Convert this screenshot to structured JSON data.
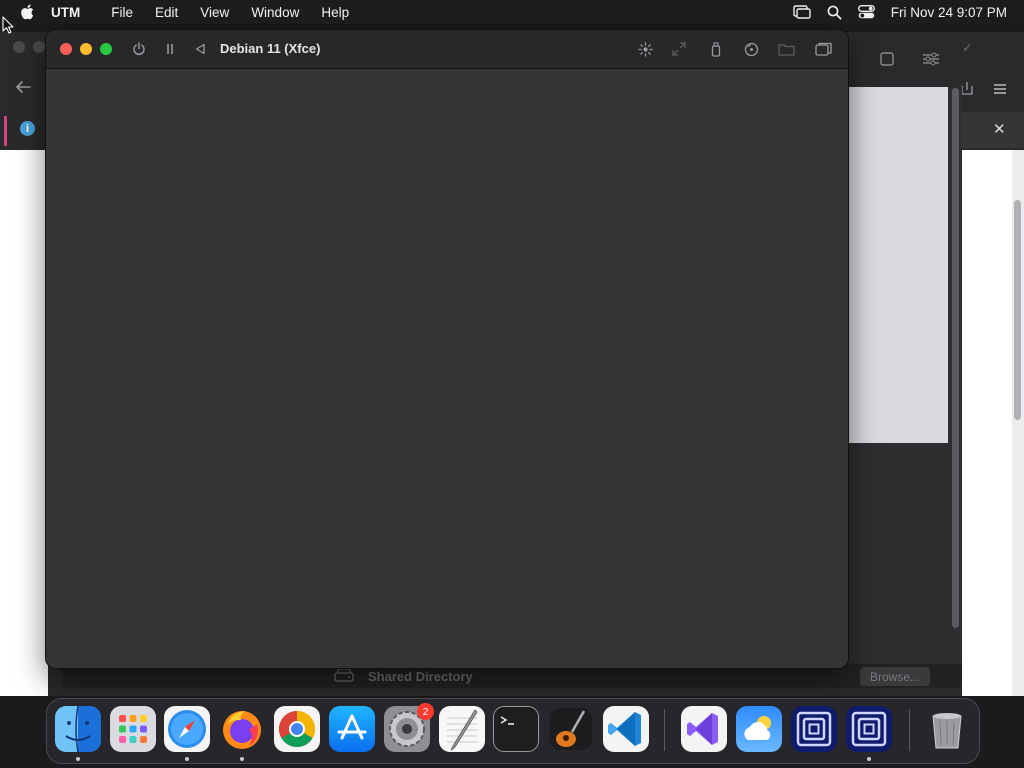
{
  "menubar": {
    "app_name": "UTM",
    "items": [
      "File",
      "Edit",
      "View",
      "Window",
      "Help"
    ],
    "clock": "Fri Nov 24  9:07 PM",
    "status_icons": [
      "screen-mirroring-icon",
      "spotlight-search-icon",
      "control-center-icon"
    ]
  },
  "vm_window": {
    "title": "Debian 11 (Xfce)",
    "controls": [
      "power-icon",
      "pause-icon",
      "restart-icon"
    ],
    "toolbar": [
      "display-brightness-icon",
      "resize-icon",
      "usb-icon",
      "drive-icon",
      "shared-folder-icon",
      "windows-icon"
    ],
    "traffic_colors": {
      "close": "#ff5f57",
      "minimize": "#febc2e",
      "maximize": "#28c840"
    }
  },
  "background_window": {
    "shared_directory_label": "Shared Directory",
    "browse_button": "Browse...",
    "info_badge": "i",
    "close_glyph": "✕"
  },
  "dock": {
    "apps": [
      {
        "name": "Finder",
        "running": true
      },
      {
        "name": "Launchpad",
        "running": false
      },
      {
        "name": "Safari",
        "running": true
      },
      {
        "name": "Firefox",
        "running": true
      },
      {
        "name": "Google Chrome",
        "running": false
      },
      {
        "name": "App Store",
        "running": false
      },
      {
        "name": "System Settings",
        "running": false,
        "badge": "2"
      },
      {
        "name": "TextEdit",
        "running": false
      },
      {
        "name": "Terminal",
        "running": false
      },
      {
        "name": "GarageBand",
        "running": false
      },
      {
        "name": "Visual Studio Code",
        "running": false
      },
      {
        "name": "Visual Studio",
        "running": false
      },
      {
        "name": "Weather",
        "running": false
      },
      {
        "name": "UTM",
        "running": false
      },
      {
        "name": "UTM",
        "running": true
      },
      {
        "name": "Trash",
        "running": false
      }
    ]
  }
}
